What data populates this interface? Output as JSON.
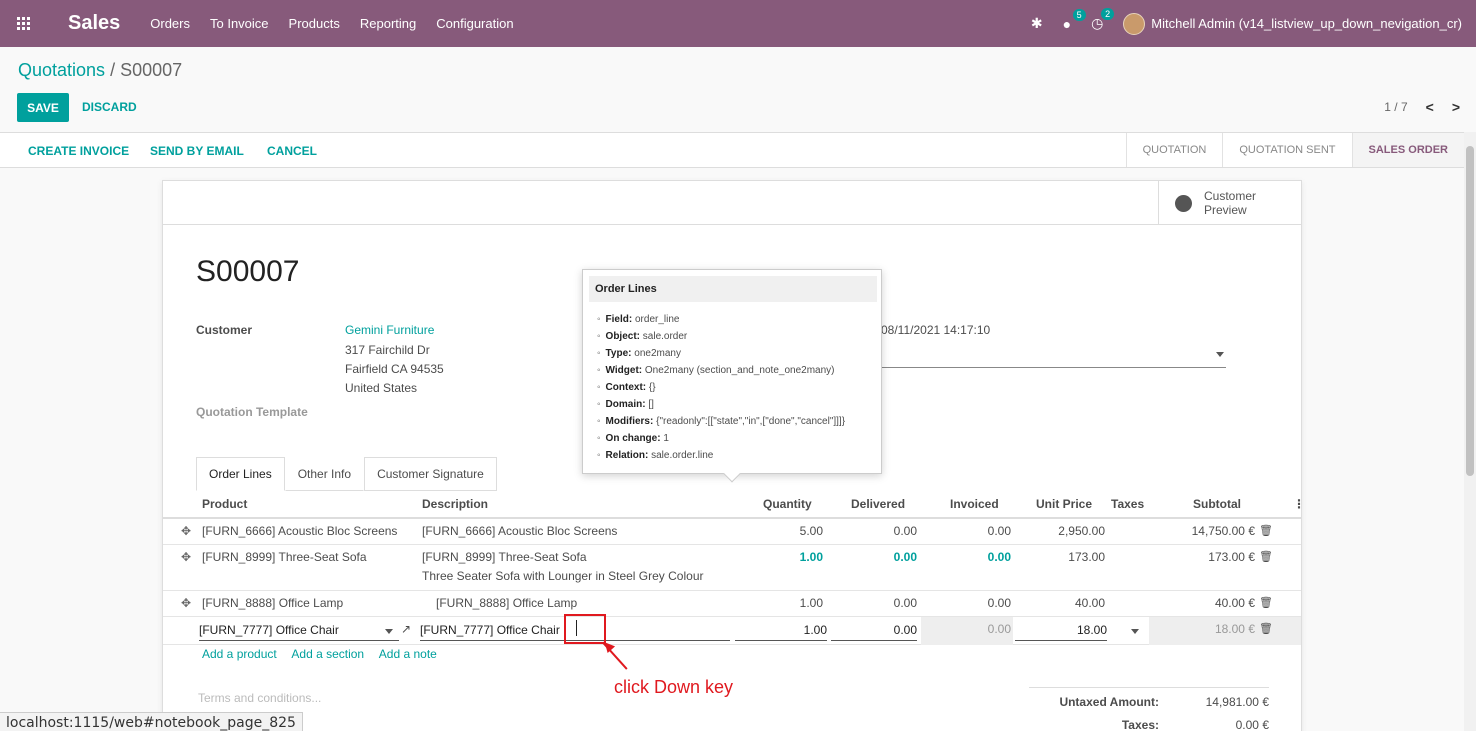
{
  "navbar": {
    "app_name": "Sales",
    "menu": [
      "Orders",
      "To Invoice",
      "Products",
      "Reporting",
      "Configuration"
    ],
    "messages_count": "5",
    "activities_count": "2",
    "user": "Mitchell Admin (v14_listview_up_down_nevigation_cr)"
  },
  "breadcrumb": {
    "parent": "Quotations",
    "separator": "/",
    "current": "S00007"
  },
  "buttons": {
    "save": "SAVE",
    "discard": "DISCARD"
  },
  "pager": {
    "value": "1 / 7",
    "prev": "<",
    "next": ">"
  },
  "statusbar": {
    "actions": [
      "CREATE INVOICE",
      "SEND BY EMAIL",
      "CANCEL"
    ],
    "stages": [
      "QUOTATION",
      "QUOTATION SENT",
      "SALES ORDER"
    ],
    "active_stage": "SALES ORDER"
  },
  "sheet": {
    "customer_preview": "Customer Preview",
    "order_name": "S00007",
    "customer_label": "Customer",
    "customer_name": "Gemini Furniture",
    "address": [
      "317 Fairchild Dr",
      "Fairfield CA 94535",
      "United States"
    ],
    "quotation_template_label": "Quotation Template",
    "date": "08/11/2021 14:17:10"
  },
  "tabs": [
    "Order Lines",
    "Other Info",
    "Customer Signature"
  ],
  "table": {
    "headers": {
      "product": "Product",
      "description": "Description",
      "quantity": "Quantity",
      "delivered": "Delivered",
      "invoiced": "Invoiced",
      "unit_price": "Unit Price",
      "taxes": "Taxes",
      "subtotal": "Subtotal"
    },
    "rows": [
      {
        "product": "[FURN_6666] Acoustic Bloc Screens",
        "description": "[FURN_6666] Acoustic Bloc Screens",
        "description2": "",
        "quantity": "5.00",
        "delivered": "0.00",
        "invoiced": "0.00",
        "unit_price": "2,950.00",
        "subtotal": "14,750.00 €"
      },
      {
        "product": "[FURN_8999] Three-Seat Sofa",
        "description": "[FURN_8999] Three-Seat Sofa",
        "description2": "Three Seater Sofa with Lounger in Steel Grey Colour",
        "quantity": "1.00",
        "delivered": "0.00",
        "invoiced": "0.00",
        "unit_price": "173.00",
        "subtotal": "173.00 €"
      },
      {
        "product": "[FURN_8888] Office Lamp",
        "description": "[FURN_8888] Office Lamp",
        "description2": "",
        "quantity": "1.00",
        "delivered": "0.00",
        "invoiced": "0.00",
        "unit_price": "40.00",
        "subtotal": "40.00 €"
      }
    ],
    "edit_row": {
      "product": "[FURN_7777] Office Chair",
      "description": "[FURN_7777] Office Chair",
      "quantity": "1.00",
      "delivered": "0.00",
      "invoiced": "0.00",
      "unit_price": "18.00",
      "subtotal": "18.00 €"
    },
    "add_links": [
      "Add a product",
      "Add a section",
      "Add a note"
    ]
  },
  "footer": {
    "terms_placeholder": "Terms and conditions...",
    "untaxed_label": "Untaxed Amount:",
    "untaxed_value": "14,981.00 €",
    "taxes_label": "Taxes:",
    "taxes_value": "0.00 €"
  },
  "tooltip": {
    "title": "Order Lines",
    "items": [
      {
        "key": "Field:",
        "value": "order_line"
      },
      {
        "key": "Object:",
        "value": "sale.order"
      },
      {
        "key": "Type:",
        "value": "one2many"
      },
      {
        "key": "Widget:",
        "value": "One2many (section_and_note_one2many)"
      },
      {
        "key": "Context:",
        "value": "{}"
      },
      {
        "key": "Domain:",
        "value": "[]"
      },
      {
        "key": "Modifiers:",
        "value": "{\"readonly\":[[\"state\",\"in\",[\"done\",\"cancel\"]]]}"
      },
      {
        "key": "On change:",
        "value": "1"
      },
      {
        "key": "Relation:",
        "value": "sale.order.line"
      }
    ]
  },
  "annotation": {
    "text": "click Down key"
  },
  "status_url": "localhost:1115/web#notebook_page_825",
  "colors": {
    "brand": "#875a7b",
    "accent": "#00a09d",
    "annotation": "#e0191f"
  }
}
